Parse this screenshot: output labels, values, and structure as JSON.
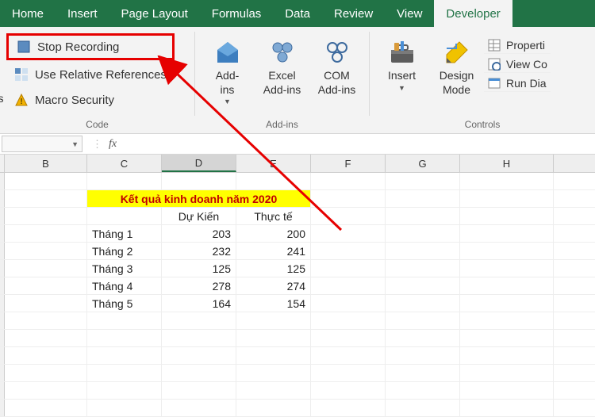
{
  "tabs": {
    "home": "Home",
    "insert": "Insert",
    "pagelayout": "Page Layout",
    "formulas": "Formulas",
    "data": "Data",
    "review": "Review",
    "view": "View",
    "developer": "Developer"
  },
  "ribbon": {
    "code": {
      "stop_recording": "Stop Recording",
      "use_relative": "Use Relative References",
      "macro_security": "Macro Security",
      "group_label": "Code",
      "macros_side": "cros"
    },
    "addins": {
      "addins": "Add-\nins",
      "excel_addins": "Excel\nAdd-ins",
      "com_addins": "COM\nAdd-ins",
      "group_label": "Add-ins"
    },
    "controls": {
      "insert": "Insert",
      "design_mode": "Design\nMode",
      "properties": "Properti",
      "view_code": "View Co",
      "run_dialog": "Run Dia",
      "group_label": "Controls"
    }
  },
  "formula_bar": {
    "namebox": "",
    "fx": "fx",
    "value": ""
  },
  "cols": [
    "B",
    "C",
    "D",
    "E",
    "F",
    "G",
    "H"
  ],
  "selected_col": "D",
  "sheet": {
    "title": "Kết quả kinh doanh năm 2020",
    "h1": "Dự Kiến",
    "h2": "Thực tế",
    "rows": [
      {
        "label": "Tháng 1",
        "a": "203",
        "b": "200"
      },
      {
        "label": "Tháng 2",
        "a": "232",
        "b": "241"
      },
      {
        "label": "Tháng 3",
        "a": "125",
        "b": "125"
      },
      {
        "label": "Tháng 4",
        "a": "278",
        "b": "274"
      },
      {
        "label": "Tháng 5",
        "a": "164",
        "b": "154"
      }
    ]
  },
  "chart_data": {
    "type": "table",
    "title": "Kết quả kinh doanh năm 2020",
    "categories": [
      "Tháng 1",
      "Tháng 2",
      "Tháng 3",
      "Tháng 4",
      "Tháng 5"
    ],
    "series": [
      {
        "name": "Dự Kiến",
        "values": [
          203,
          232,
          125,
          278,
          164
        ]
      },
      {
        "name": "Thực tế",
        "values": [
          200,
          241,
          125,
          274,
          154
        ]
      }
    ]
  }
}
